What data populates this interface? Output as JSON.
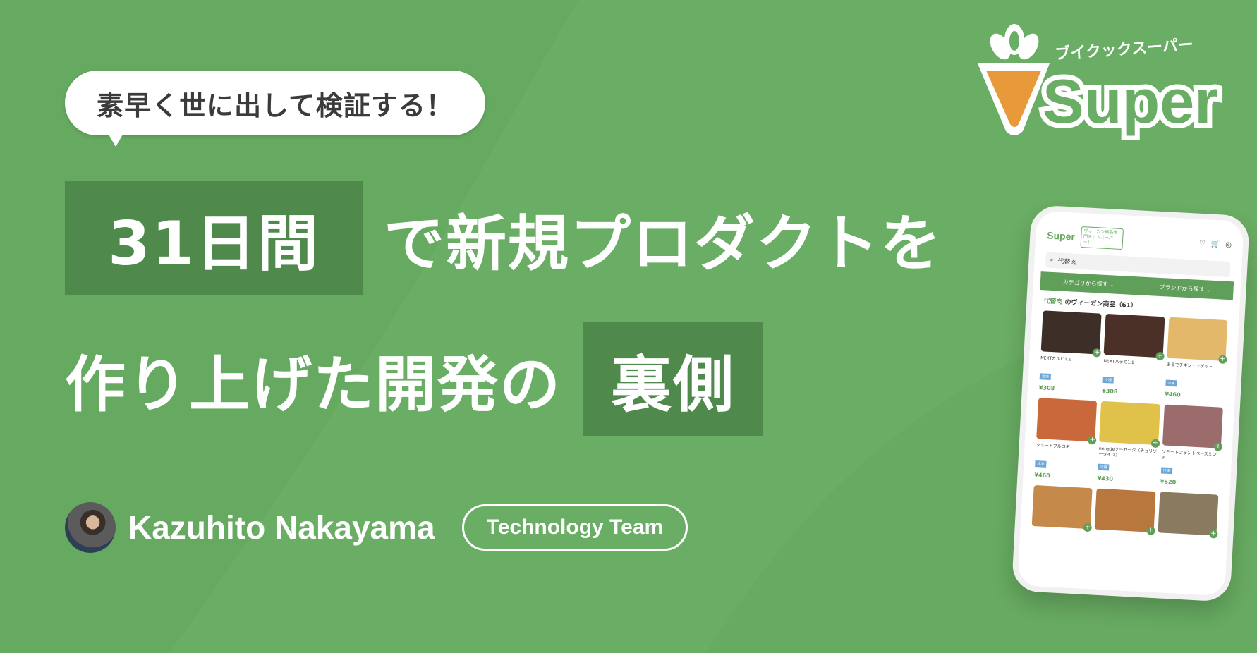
{
  "colors": {
    "background": "#6aad64",
    "highlight": "#4f8a4c",
    "accent_orange": "#e89a3a",
    "accent_green": "#5f9f59"
  },
  "bubble": {
    "text": "素早く世に出して検証する！"
  },
  "title": {
    "line1_highlight": "31日間",
    "line1_rest": "で新規プロダクトを",
    "line2_rest": "作り上げた開発の",
    "line2_highlight": "裏側"
  },
  "author": {
    "name": "Kazuhito Nakayama",
    "team": "Technology Team"
  },
  "logo": {
    "kana": "ブイクックスーパー",
    "wordmark": "Super"
  },
  "phone": {
    "logo": "Super",
    "tag": "ヴィーガン商品専門ネットスーパー！",
    "search_value": "代替肉",
    "nav_items": [
      "カテゴリから探す ⌄",
      "ブランドから探す ⌄"
    ],
    "heading_keyword": "代替肉",
    "heading_rest": "のヴィーガン商品（61）",
    "products": [
      {
        "name": "NEXTカルビ1.1",
        "badge": "冷凍",
        "price": "¥308",
        "color": "#3d2f28"
      },
      {
        "name": "NEXTハラミ1.1",
        "badge": "冷凍",
        "price": "¥308",
        "color": "#4a3026"
      },
      {
        "name": "まるでチキン・ナゲット",
        "badge": "冷凍",
        "price": "¥460",
        "color": "#e3b86b"
      },
      {
        "name": "ソミートプルコギ",
        "badge": "冷凍",
        "price": "¥460",
        "color": "#c9683a"
      },
      {
        "name": "nenadeソーセージ（チョリソータイプ）",
        "badge": "冷蔵",
        "price": "¥430",
        "color": "#e0c24a"
      },
      {
        "name": "ソミートプラントベースミンチ",
        "badge": "冷凍",
        "price": "¥520",
        "color": "#9c6b6b"
      },
      {
        "name": "",
        "badge": "",
        "price": "",
        "color": "#c58a4a"
      },
      {
        "name": "",
        "badge": "",
        "price": "",
        "color": "#b8773c"
      },
      {
        "name": "",
        "badge": "",
        "price": "",
        "color": "#8a7a60"
      }
    ]
  }
}
